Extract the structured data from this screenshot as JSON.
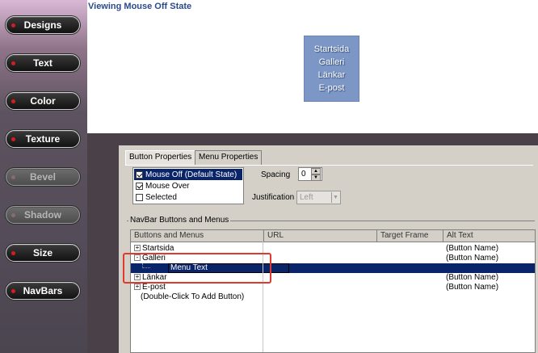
{
  "sidebar": {
    "buttons": [
      {
        "label": "Designs",
        "enabled": true
      },
      {
        "label": "Text",
        "enabled": true
      },
      {
        "label": "Color",
        "enabled": true
      },
      {
        "label": "Texture",
        "enabled": true
      },
      {
        "label": "Bevel",
        "enabled": false
      },
      {
        "label": "Shadow",
        "enabled": false
      },
      {
        "label": "Size",
        "enabled": true
      },
      {
        "label": "NavBars",
        "enabled": true
      }
    ]
  },
  "preview": {
    "title": "Viewing Mouse Off State",
    "menu_items": [
      "Startsida",
      "Galleri",
      "Länkar",
      "E-post"
    ]
  },
  "dialog": {
    "tabs": [
      "Button Properties",
      "Menu Properties"
    ],
    "states": [
      {
        "label": "Mouse Off (Default State)",
        "checked": true,
        "selected": true
      },
      {
        "label": "Mouse Over",
        "checked": true,
        "selected": false
      },
      {
        "label": "Selected",
        "checked": false,
        "selected": false
      }
    ],
    "spacing_label": "Spacing",
    "spacing_value": "0",
    "justification_label": "Justification",
    "justification_value": "Left",
    "group_title": "NavBar Buttons and Menus",
    "columns": [
      "Buttons and Menus",
      "URL",
      "Target Frame",
      "Alt Text"
    ],
    "rows": [
      {
        "tree": "+",
        "name": "Startsida",
        "alt": "(Button Name)"
      },
      {
        "tree": "-",
        "name": "Galleri",
        "alt": "(Button Name)"
      },
      {
        "tree": "",
        "name": "Menu Text",
        "alt": "",
        "editing": true
      },
      {
        "tree": "+",
        "name": "Länkar",
        "alt": "(Button Name)"
      },
      {
        "tree": "+",
        "name": "E-post",
        "alt": "(Button Name)"
      },
      {
        "tree": "",
        "name": "(Double-Click To Add Button)",
        "alt": ""
      }
    ]
  },
  "colors": {
    "accent_blue": "#0a246a",
    "highlight_red": "#e0392e",
    "preview_menu_bg": "#7c97c6"
  }
}
